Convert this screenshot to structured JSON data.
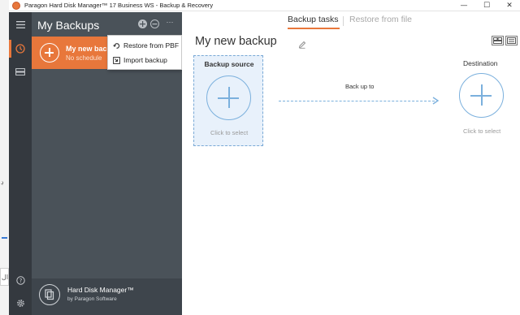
{
  "window": {
    "title": "Paragon Hard Disk Manager™ 17 Business WS - Backup & Recovery",
    "controls": {
      "minimize": "—",
      "maximize": "☐",
      "close": "✕"
    }
  },
  "rail": {
    "items": [
      {
        "name": "menu",
        "icon": "hamburger-icon"
      },
      {
        "name": "backup",
        "icon": "clock-backup-icon",
        "active": true
      },
      {
        "name": "disks",
        "icon": "drive-icon"
      },
      {
        "name": "help",
        "icon": "help-icon"
      },
      {
        "name": "settings",
        "icon": "gear-icon"
      }
    ]
  },
  "panel": {
    "title": "My Backups",
    "tools": [
      "add-icon",
      "remove-icon",
      "more-icon"
    ],
    "more_label": "···",
    "item": {
      "name": "My new backup",
      "subtitle": "No schedule"
    },
    "footer": {
      "product": "Hard Disk Manager™",
      "vendor": "by Paragon Software"
    }
  },
  "context_menu": {
    "items": [
      {
        "label": "Restore from PBF",
        "icon": "restore-icon"
      },
      {
        "label": "Import backup",
        "icon": "import-icon"
      }
    ]
  },
  "main": {
    "tabs": [
      {
        "label": "Backup tasks",
        "active": true
      },
      {
        "label": "Restore from file",
        "active": false
      }
    ],
    "title": "My new backup",
    "source": {
      "label": "Backup source",
      "action": "Click to select"
    },
    "flow_label": "Back up to",
    "destination": {
      "label": "Destination",
      "action": "Click to select"
    }
  },
  "desktop_fragments": [
    "ڊ",
    "ال"
  ],
  "colors": {
    "accent": "#e8773b",
    "rail": "#34393f",
    "panel": "#4a5259",
    "selection_fill": "#e8f1fb",
    "plus_stroke": "#7bb0dd"
  }
}
